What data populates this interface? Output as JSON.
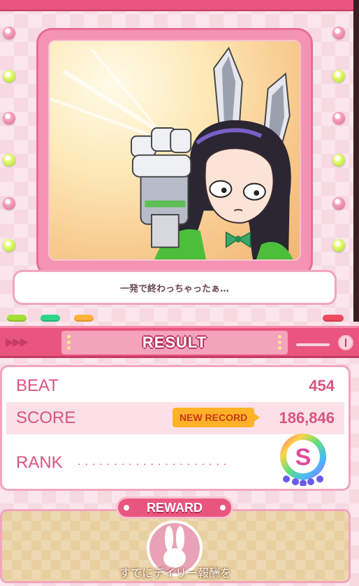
{
  "speech": {
    "text": "一発で終わっちゃったぁ…"
  },
  "header": {
    "title": "RESULT",
    "arrows": "▶▶▶"
  },
  "results": {
    "beat_label": "BEAT",
    "beat_value": "454",
    "score_label": "SCORE",
    "new_record": "NEW RECORD",
    "score_value": "186,846",
    "rank_label": "RANK",
    "rank_dots": "·····················",
    "rank_grade": "S"
  },
  "reward": {
    "title": "REWARD",
    "message": "すでにデイリー報酬を"
  },
  "colors": {
    "accent": "#e9557f",
    "text": "#d9557d",
    "new_record": "#ffb228"
  }
}
